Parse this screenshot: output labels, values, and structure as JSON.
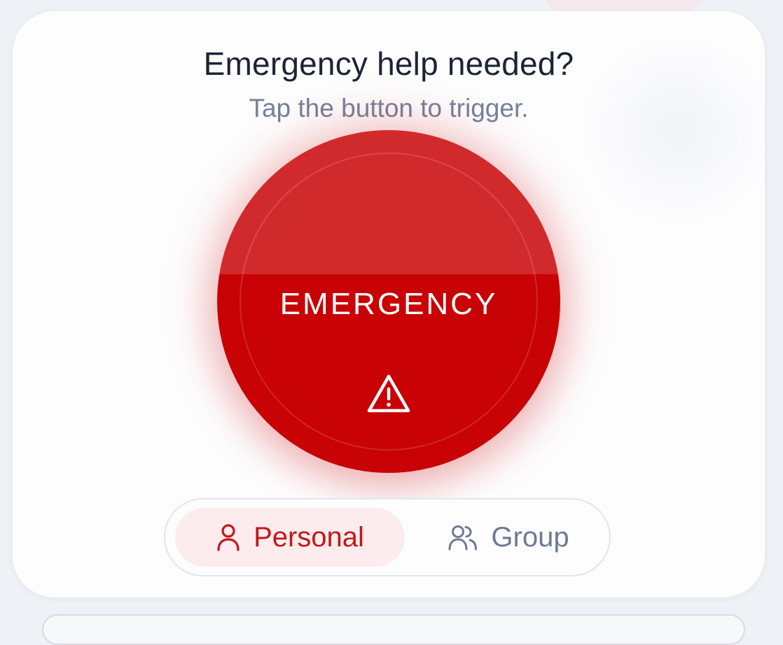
{
  "header": {
    "title": "Emergency help needed?",
    "subtitle": "Tap the button to trigger."
  },
  "sos_button": {
    "label": "EMERGENCY",
    "icon": "warning-triangle-icon"
  },
  "mode_toggle": {
    "selected": "Personal",
    "options": [
      {
        "label": "Personal",
        "icon": "user-icon"
      },
      {
        "label": "Group",
        "icon": "users-icon"
      }
    ]
  },
  "colors": {
    "accent": "#c80205",
    "accent_light": "#d12a2d",
    "selected_bg": "#fdeced",
    "muted_text": "#74819a",
    "title_text": "#1c2433"
  }
}
